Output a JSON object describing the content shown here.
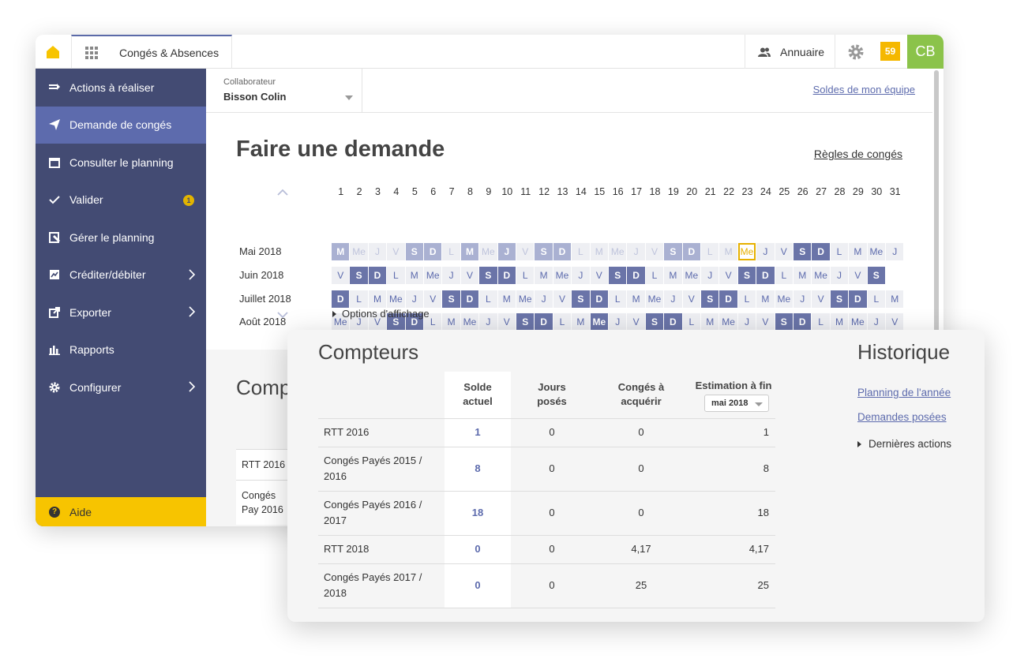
{
  "topbar": {
    "app_title": "Congés & Absences",
    "annuaire_label": "Annuaire",
    "notification_count": "59",
    "avatar_initials": "CB",
    "colors": {
      "brand_yellow": "#f7c400",
      "avatar_green": "#8bc34a"
    }
  },
  "sidebar": {
    "items": [
      {
        "label": "Actions à réaliser",
        "icon": "list-icon"
      },
      {
        "label": "Demande de congés",
        "icon": "paper-plane-icon",
        "active": true
      },
      {
        "label": "Consulter le planning",
        "icon": "calendar-icon"
      },
      {
        "label": "Valider",
        "icon": "check-icon",
        "badge": "1"
      },
      {
        "label": "Gérer le planning",
        "icon": "planning-edit-icon"
      },
      {
        "label": "Créditer/débiter",
        "icon": "credit-icon",
        "has_submenu": true
      },
      {
        "label": "Exporter",
        "icon": "export-icon",
        "has_submenu": true
      },
      {
        "label": "Rapports",
        "icon": "bar-chart-icon"
      },
      {
        "label": "Configurer",
        "icon": "gear-icon",
        "has_submenu": true
      }
    ],
    "help_label": "Aide",
    "help_icon": "?",
    "colors": {
      "background": "#434b73",
      "active": "#5d6bad"
    }
  },
  "main": {
    "collaborator_label": "Collaborateur",
    "collaborator_value": "Bisson Colin",
    "team_balances_link": "Soldes de mon équipe",
    "page_title": "Faire une demande",
    "rules_link": "Règles de congés",
    "options_label": "Options d'affichage",
    "calendar": {
      "day_numbers": [
        "1",
        "2",
        "3",
        "4",
        "5",
        "6",
        "7",
        "8",
        "9",
        "10",
        "11",
        "12",
        "13",
        "14",
        "15",
        "16",
        "17",
        "18",
        "19",
        "20",
        "21",
        "22",
        "23",
        "24",
        "25",
        "26",
        "27",
        "28",
        "29",
        "30",
        "31"
      ],
      "months": [
        {
          "label": "Mai 2018",
          "days": [
            "M",
            "Me",
            "J",
            "V",
            "S",
            "D",
            "L",
            "M",
            "Me",
            "J",
            "V",
            "S",
            "D",
            "L",
            "M",
            "Me",
            "J",
            "V",
            "S",
            "D",
            "L",
            "M",
            "Me",
            "J",
            "V",
            "S",
            "D",
            "L",
            "M",
            "Me",
            "J"
          ],
          "types": [
            "welight",
            "light",
            "light",
            "light",
            "welight",
            "welight",
            "light",
            "welight",
            "light",
            "welight",
            "light",
            "welight",
            "welight",
            "light",
            "light",
            "light",
            "light",
            "light",
            "welight",
            "welight",
            "light",
            "light",
            "today",
            "norm",
            "norm",
            "we",
            "we",
            "norm",
            "norm",
            "norm",
            "norm"
          ]
        },
        {
          "label": "Juin 2018",
          "days": [
            "V",
            "S",
            "D",
            "L",
            "M",
            "Me",
            "J",
            "V",
            "S",
            "D",
            "L",
            "M",
            "Me",
            "J",
            "V",
            "S",
            "D",
            "L",
            "M",
            "Me",
            "J",
            "V",
            "S",
            "D",
            "L",
            "M",
            "Me",
            "J",
            "V",
            "S"
          ],
          "types": [
            "norm",
            "we",
            "we",
            "norm",
            "norm",
            "norm",
            "norm",
            "norm",
            "we",
            "we",
            "norm",
            "norm",
            "norm",
            "norm",
            "norm",
            "we",
            "we",
            "norm",
            "norm",
            "norm",
            "norm",
            "norm",
            "we",
            "we",
            "norm",
            "norm",
            "norm",
            "norm",
            "norm",
            "we"
          ]
        },
        {
          "label": "Juillet 2018",
          "days": [
            "D",
            "L",
            "M",
            "Me",
            "J",
            "V",
            "S",
            "D",
            "L",
            "M",
            "Me",
            "J",
            "V",
            "S",
            "D",
            "L",
            "M",
            "Me",
            "J",
            "V",
            "S",
            "D",
            "L",
            "M",
            "Me",
            "J",
            "V",
            "S",
            "D",
            "L",
            "M"
          ],
          "types": [
            "we",
            "norm",
            "norm",
            "norm",
            "norm",
            "norm",
            "we",
            "we",
            "norm",
            "norm",
            "norm",
            "norm",
            "norm",
            "we",
            "we",
            "norm",
            "norm",
            "norm",
            "norm",
            "norm",
            "we",
            "we",
            "norm",
            "norm",
            "norm",
            "norm",
            "norm",
            "we",
            "we",
            "norm",
            "norm"
          ]
        },
        {
          "label": "Août 2018",
          "days": [
            "Me",
            "J",
            "V",
            "S",
            "D",
            "L",
            "M",
            "Me",
            "J",
            "V",
            "S",
            "D",
            "L",
            "M",
            "Me",
            "J",
            "V",
            "S",
            "D",
            "L",
            "M",
            "Me",
            "J",
            "V",
            "S",
            "D",
            "L",
            "M",
            "Me",
            "J",
            "V"
          ],
          "types": [
            "norm",
            "norm",
            "norm",
            "we",
            "we",
            "norm",
            "norm",
            "norm",
            "norm",
            "norm",
            "we",
            "we",
            "norm",
            "norm",
            "we",
            "norm",
            "norm",
            "we",
            "we",
            "norm",
            "norm",
            "norm",
            "norm",
            "norm",
            "we",
            "we",
            "norm",
            "norm",
            "norm",
            "norm",
            "norm"
          ]
        }
      ]
    },
    "background_counters_title": "Comp",
    "background_rows": [
      "RTT 2016",
      "Congés Pay 2016"
    ]
  },
  "counters": {
    "title": "Compteurs",
    "headers": {
      "solde": [
        "Solde",
        "actuel"
      ],
      "jours": [
        "Jours",
        "posés"
      ],
      "acquerir": [
        "Congés à",
        "acquérir"
      ],
      "estimation": "Estimation à fin"
    },
    "estimation_select": "mai 2018",
    "rows": [
      {
        "label": [
          "RTT 2016"
        ],
        "solde": "1",
        "jours": "0",
        "acquerir": "0",
        "estimation": "1"
      },
      {
        "label": [
          "Congés Payés 2015 /",
          "2016"
        ],
        "solde": "8",
        "jours": "0",
        "acquerir": "0",
        "estimation": "8"
      },
      {
        "label": [
          "Congés Payés 2016 /",
          "2017"
        ],
        "solde": "18",
        "jours": "0",
        "acquerir": "0",
        "estimation": "18"
      },
      {
        "label": [
          "RTT 2018"
        ],
        "solde": "0",
        "jours": "0",
        "acquerir": "4,17",
        "estimation": "4,17"
      },
      {
        "label": [
          "Congés Payés 2017 /",
          "2018"
        ],
        "solde": "0",
        "jours": "0",
        "acquerir": "25",
        "estimation": "25"
      }
    ]
  },
  "history": {
    "title": "Historique",
    "links": [
      "Planning de l'année",
      "Demandes posées"
    ],
    "last_actions": "Dernières actions"
  }
}
